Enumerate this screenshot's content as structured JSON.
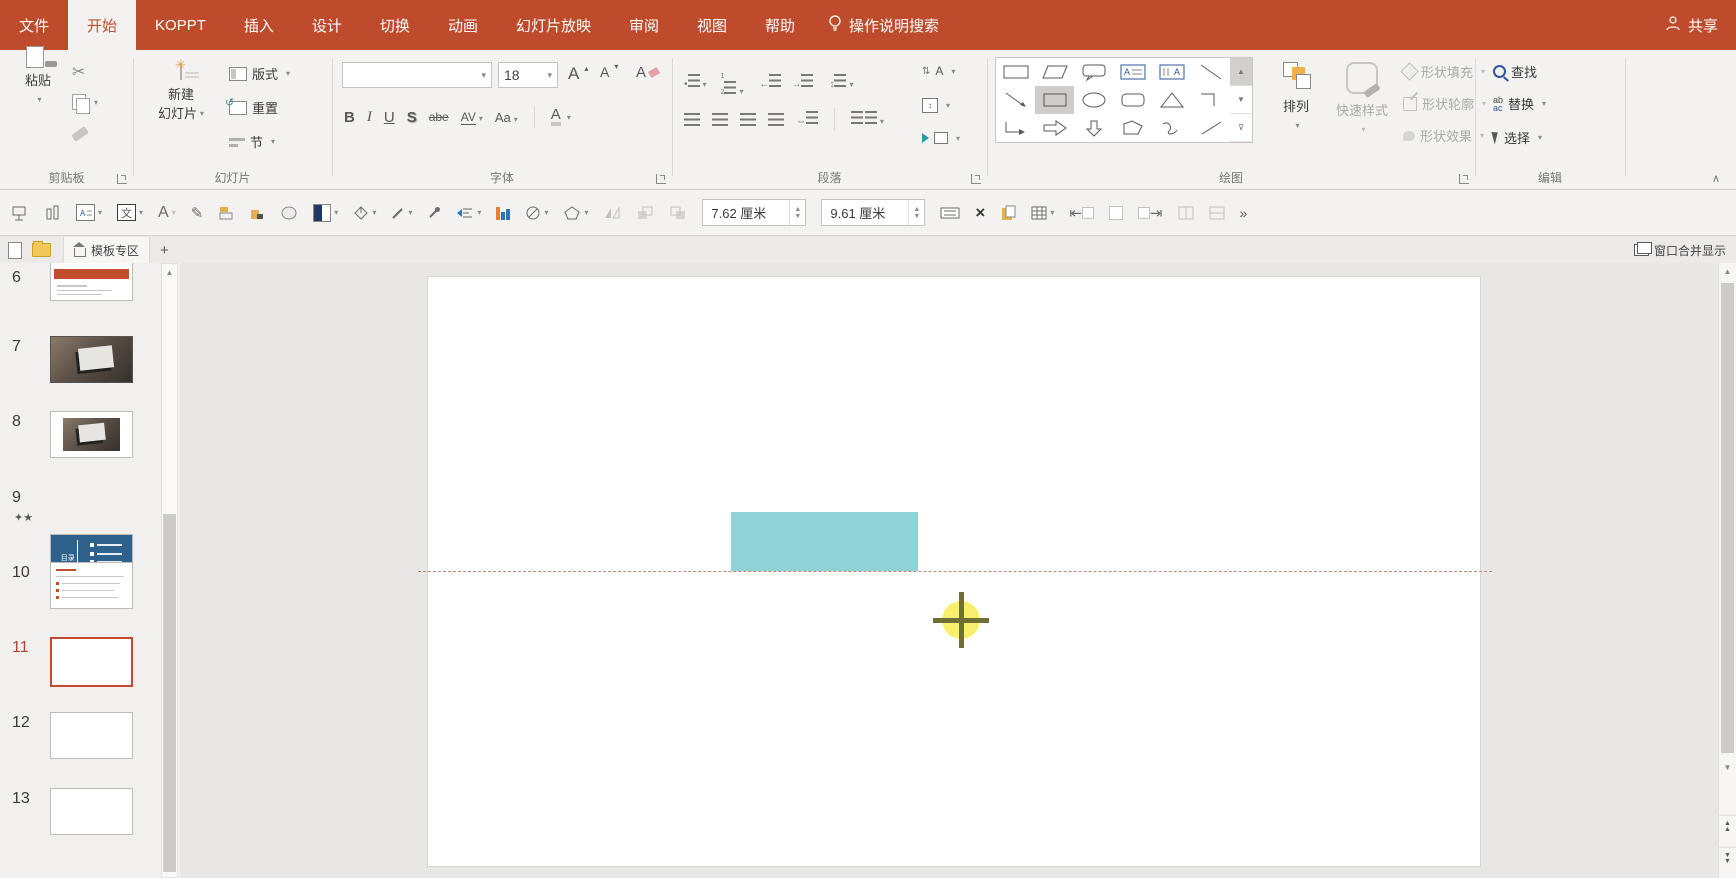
{
  "app": {
    "accent_red": "#BE4B2C",
    "selected_slide_border": "#C5492F",
    "teal_shape_color": "#8FD3D6",
    "guide_line_color": "#B98A6F",
    "plus_cursor_color": "#F8EF6D"
  },
  "titlebar": {
    "tabs": [
      {
        "label": "文件"
      },
      {
        "label": "开始",
        "active": true
      },
      {
        "label": "KOPPT"
      },
      {
        "label": "插入"
      },
      {
        "label": "设计"
      },
      {
        "label": "切换"
      },
      {
        "label": "动画"
      },
      {
        "label": "幻灯片放映"
      },
      {
        "label": "审阅"
      },
      {
        "label": "视图"
      },
      {
        "label": "帮助"
      }
    ],
    "search_label": "操作说明搜索",
    "share_label": "共享"
  },
  "ribbon": {
    "clipboard": {
      "group_label": "剪贴板",
      "paste_label": "粘贴"
    },
    "slides": {
      "group_label": "幻灯片",
      "new_slide_line1": "新建",
      "new_slide_line2": "幻灯片",
      "layout_label": "版式",
      "reset_label": "重置",
      "section_label": "节"
    },
    "font": {
      "group_label": "字体",
      "font_size": "18",
      "bold": "B",
      "italic": "I",
      "underline": "U",
      "shadow": "S",
      "strikethrough": "abe",
      "char_spacing": "AV",
      "change_case": "Aa",
      "font_color": "A",
      "grow_font": "A",
      "shrink_font": "A",
      "clear_format": "A"
    },
    "paragraph": {
      "group_label": "段落"
    },
    "drawing": {
      "group_label": "绘图",
      "arrange_label": "排列",
      "quick_styles_label": "快速样式",
      "shape_fill_label": "形状填充",
      "shape_outline_label": "形状轮廓",
      "shape_effects_label": "形状效果"
    },
    "editing": {
      "group_label": "编辑",
      "find_label": "查找",
      "replace_label": "替换",
      "select_label": "选择"
    }
  },
  "toolbar2": {
    "shape_width_value": "7.62 厘米",
    "shape_height_value": "9.61 厘米"
  },
  "tabbar": {
    "template_tab_label": "模板专区",
    "window_merge_label": "窗口合并显示"
  },
  "slides_panel": {
    "items": [
      {
        "num": "6"
      },
      {
        "num": "7"
      },
      {
        "num": "8"
      },
      {
        "num": "9",
        "toc_title": "目录",
        "starred": true
      },
      {
        "num": "10"
      },
      {
        "num": "11",
        "selected": true
      },
      {
        "num": "12"
      },
      {
        "num": "13"
      }
    ]
  }
}
